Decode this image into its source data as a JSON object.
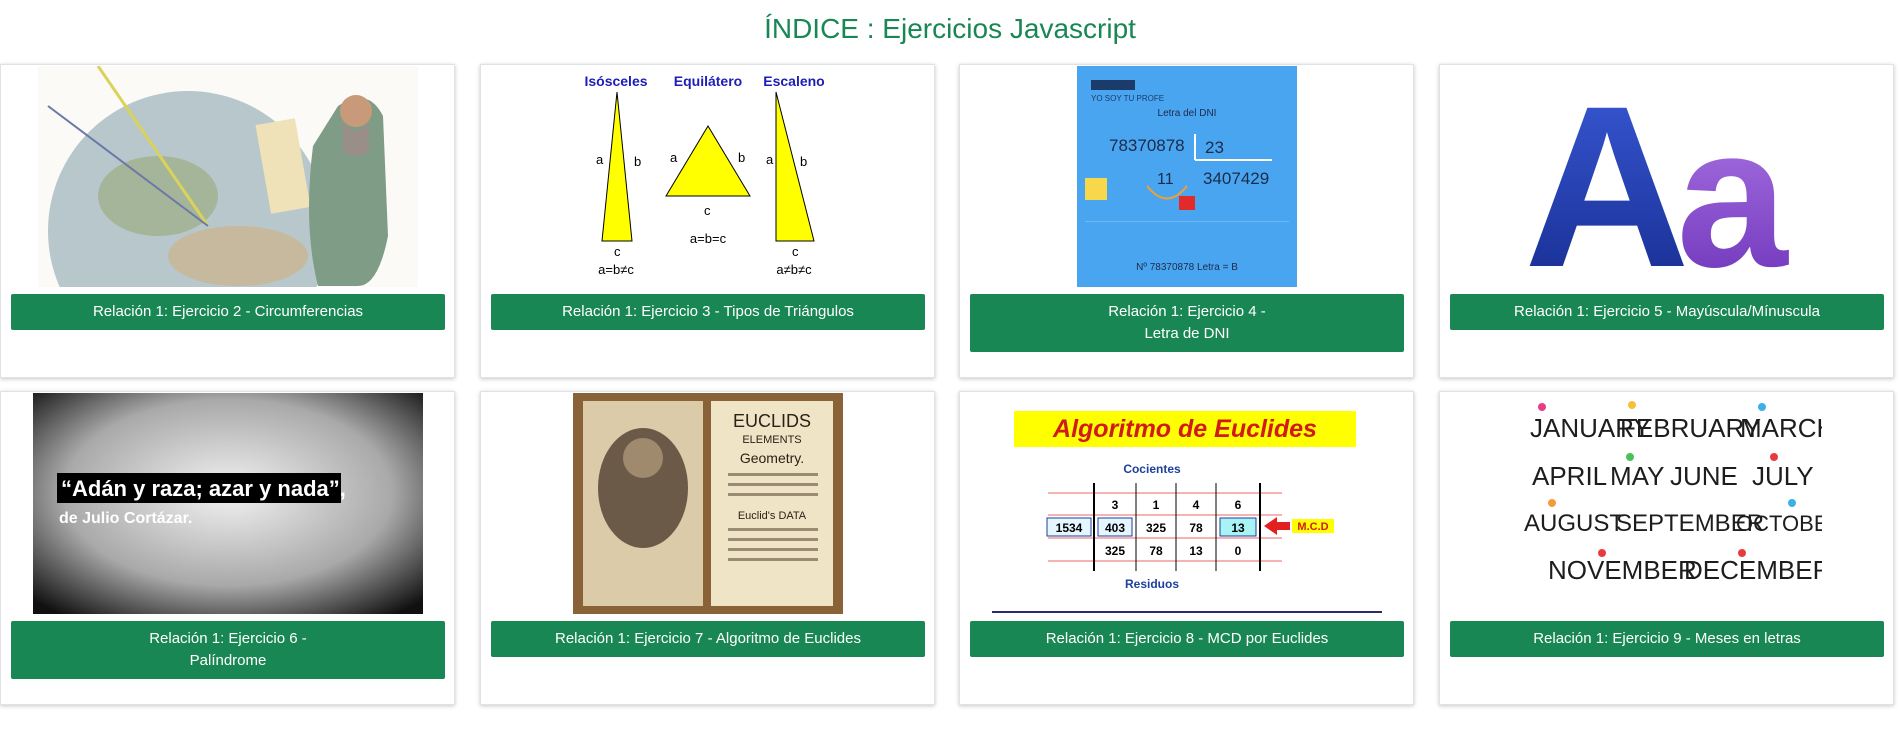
{
  "page": {
    "title": "ÍNDICE : Ejercicios Javascript"
  },
  "colors": {
    "accent": "#198754",
    "button_text": "#ffffff"
  },
  "cards": [
    {
      "button_label": "Relación 1: Ejercicio 2 - Circumferencias",
      "image": "scholar-globe-image"
    },
    {
      "button_label": "Relación 1: Ejercicio 3 - Tipos de Triángulos",
      "image": "triangle-types-image",
      "image_text": {
        "isosceles": "Isósceles",
        "equilatero": "Equilátero",
        "escaleno": "Escaleno",
        "a": "a",
        "b": "b",
        "c": "c",
        "f1": "a=b≠c",
        "f2": "a=b=c",
        "f3": "a≠b≠c"
      }
    },
    {
      "button_label": "Relación 1: Ejercicio 4 -\nLetra de DNI",
      "image": "dni-letter-image",
      "image_text": {
        "brand": "YO SOY TU PROFE",
        "title": "Letra del DNI",
        "dividend": "78370878",
        "divisor": "23",
        "quotient": "3407429",
        "remainder": "11",
        "result": "Nº 78370878   Letra  = B"
      }
    },
    {
      "button_label": "Relación 1: Ejercicio 5 - Mayúscula/Mínuscula",
      "image": "uppercase-lowercase-image",
      "image_text": {
        "upper": "A",
        "lower": "a"
      }
    },
    {
      "button_label": "Relación 1: Ejercicio 6 -\nPalíndrome",
      "image": "palindrome-quote-image",
      "image_text": {
        "quote": "“Adán y raza; azar y nada”,",
        "author": "de Julio Cortázar."
      }
    },
    {
      "button_label": "Relación 1: Ejercicio 7 - Algoritmo de Euclides",
      "image": "euclid-book-image",
      "image_text": {
        "l1": "EUCLIDS",
        "l2": "ELEMENTS",
        "l3": "Geometry.",
        "l4": "Euclid's DATA"
      }
    },
    {
      "button_label": "Relación 1: Ejercicio 8 - MCD por Euclides",
      "image": "euclid-algorithm-image",
      "image_text": {
        "banner": "Algoritmo de Euclides",
        "quotients_label": "Cocientes",
        "remainders_label": "Residuos",
        "mcd": "M.C.D",
        "quotients": [
          "3",
          "1",
          "4",
          "6"
        ],
        "row": [
          "1534",
          "403",
          "325",
          "78",
          "13"
        ],
        "remainders": [
          "325",
          "78",
          "13",
          "0"
        ]
      }
    },
    {
      "button_label": "Relación 1: Ejercicio 9 - Meses en letras",
      "image": "months-image",
      "image_text": {
        "m1": "JANUARY",
        "m2": "FEBRUARY",
        "m3": "MARCH",
        "m4": "APRIL",
        "m5": "MAY",
        "m6": "JUNE",
        "m7": "JULY",
        "m8": "AUGUST",
        "m9": "SEPTEMBER",
        "m10": "OCTOBER",
        "m11": "NOVEMBER",
        "m12": "DECEMBER"
      }
    }
  ]
}
